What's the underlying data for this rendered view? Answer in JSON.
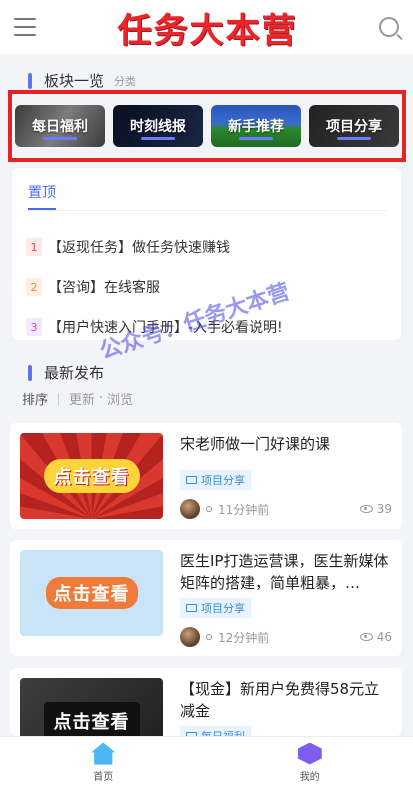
{
  "header": {
    "brand": "任务大本营",
    "menu_icon": "menu-icon",
    "search_icon": "search-icon"
  },
  "categories_section": {
    "title": "板块一览",
    "subtitle": "分类",
    "items": [
      {
        "label": "每日福利"
      },
      {
        "label": "时刻线报"
      },
      {
        "label": "新手推荐"
      },
      {
        "label": "项目分享"
      }
    ]
  },
  "pinned": {
    "tab": "置顶",
    "items": [
      {
        "num": "1",
        "text": "【返现任务】做任务快速赚钱"
      },
      {
        "num": "2",
        "text": "【咨询】在线客服"
      },
      {
        "num": "3",
        "text": "【用户快速入门手册】-入手必看说明!"
      }
    ]
  },
  "latest": {
    "title": "最新发布",
    "sort_label": "排序",
    "sort_update": "更新",
    "sort_browse": "浏览",
    "watermark": "公众号：任务大本营"
  },
  "posts": [
    {
      "thumb_text": "点击查看",
      "title": "宋老师做一门好课的课",
      "tag": "项目分享",
      "time": "11分钟前",
      "views": "39"
    },
    {
      "thumb_text": "点击查看",
      "title": "医生IP打造运营课，医生新媒体矩阵的搭建，简单粗暴，…",
      "tag": "项目分享",
      "time": "12分钟前",
      "views": "46"
    },
    {
      "thumb_text": "点击查看",
      "title": "【现金】新用户免费得58元立减金",
      "tag": "每日福利"
    }
  ],
  "tabbar": {
    "home": "首页",
    "mine": "我的"
  }
}
